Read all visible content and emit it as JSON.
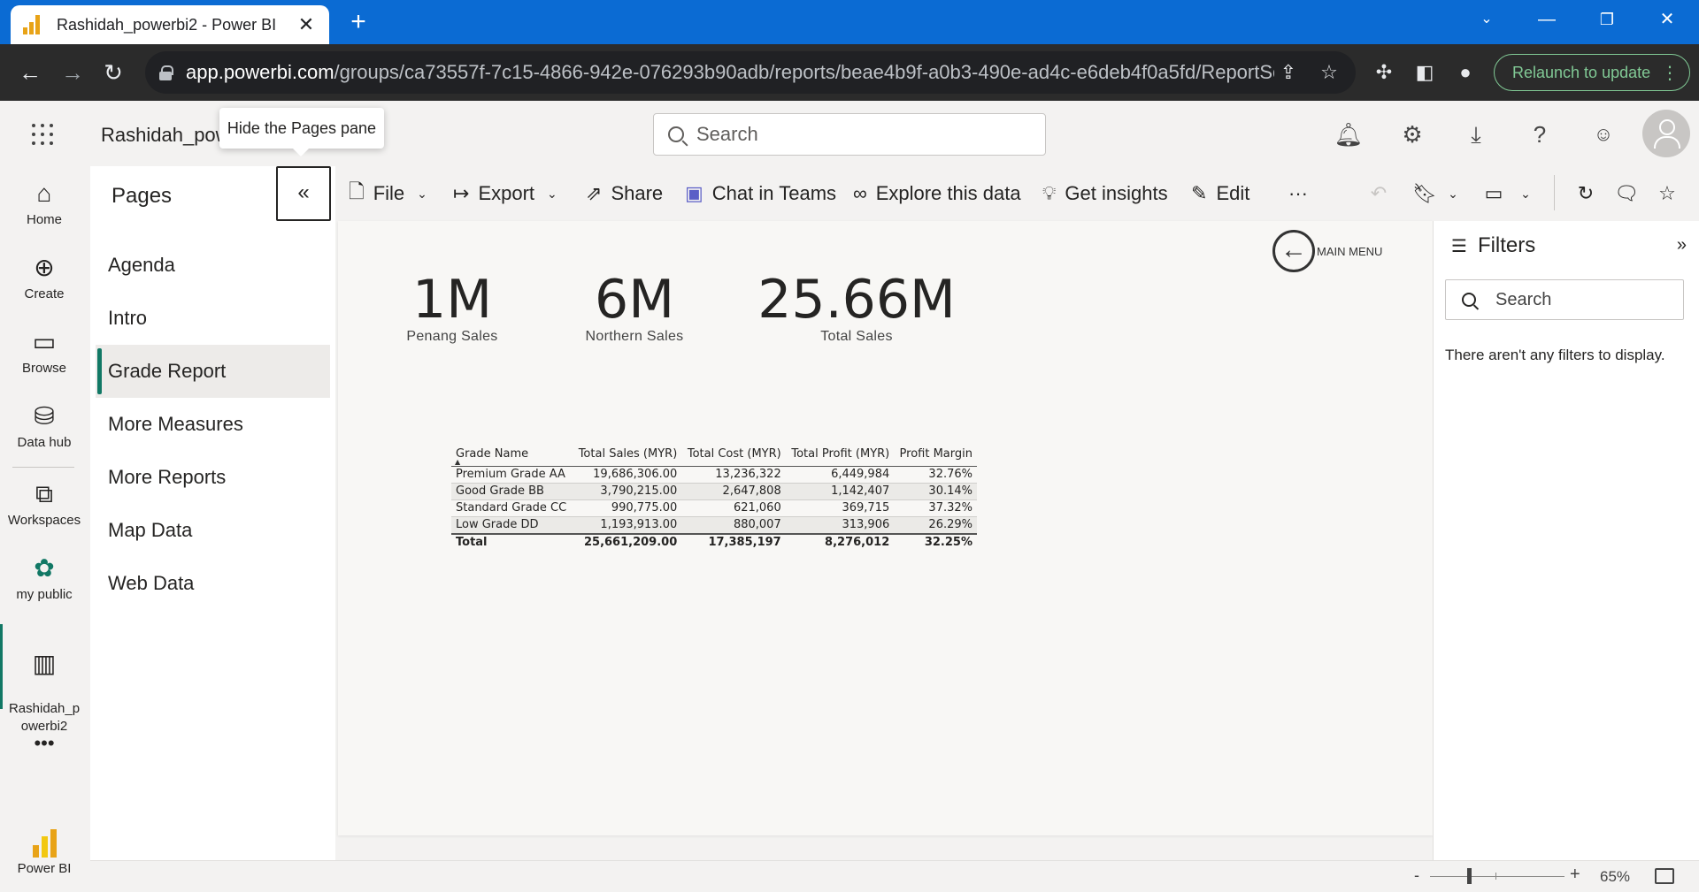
{
  "browser": {
    "tab_title": "Rashidah_powerbi2 - Power BI",
    "close_glyph": "✕",
    "newtab_glyph": "+",
    "url_host": "app.powerbi.com",
    "url_path": "/groups/ca73557f-7c15-4866-942e-076293b90adb/reports/beae4b9f-a0b3-490e-ad4c-e6deb4f0a5fd/ReportSec...",
    "relaunch_label": "Relaunch to update",
    "accent_color": "#0b6bd3"
  },
  "header": {
    "workspace_name": "Rashidah_powe",
    "tooltip": "Hide the Pages pane",
    "search_placeholder": "Search"
  },
  "leftnav": {
    "items": [
      {
        "label": "Home",
        "icon": "home-icon"
      },
      {
        "label": "Create",
        "icon": "plus-circle-icon"
      },
      {
        "label": "Browse",
        "icon": "folder-icon"
      },
      {
        "label": "Data hub",
        "icon": "database-icon"
      },
      {
        "label": "Workspaces",
        "icon": "workspaces-icon"
      },
      {
        "label": "my public",
        "icon": "people-icon"
      },
      {
        "label": "Rashidah_p\nowerbi2",
        "icon": "report-icon"
      }
    ],
    "more": "•••",
    "brand_label": "Power BI"
  },
  "pages": {
    "title": "Pages",
    "collapse_glyph": "«",
    "items": [
      {
        "label": "Agenda",
        "active": false
      },
      {
        "label": "Intro",
        "active": false
      },
      {
        "label": "Grade Report",
        "active": true
      },
      {
        "label": "More Measures",
        "active": false
      },
      {
        "label": "More Reports",
        "active": false
      },
      {
        "label": "Map Data",
        "active": false
      },
      {
        "label": "Web Data",
        "active": false
      }
    ]
  },
  "actions": {
    "file": "File",
    "export": "Export",
    "share": "Share",
    "chat": "Chat in Teams",
    "explore": "Explore this data",
    "insights": "Get insights",
    "edit": "Edit",
    "more": "···"
  },
  "report": {
    "main_menu": "MAIN MENU",
    "cards": [
      {
        "value": "1M",
        "label": "Penang Sales"
      },
      {
        "value": "6M",
        "label": "Northern Sales"
      },
      {
        "value": "25.66M",
        "label": "Total Sales"
      }
    ],
    "table": {
      "headers": [
        "Grade Name",
        "Total Sales (MYR)",
        "Total Cost (MYR)",
        "Total Profit (MYR)",
        "Profit Margin"
      ],
      "rows": [
        [
          "Premium Grade AA",
          "19,686,306.00",
          "13,236,322",
          "6,449,984",
          "32.76%"
        ],
        [
          "Good Grade BB",
          "3,790,215.00",
          "2,647,808",
          "1,142,407",
          "30.14%"
        ],
        [
          "Standard Grade CC",
          "990,775.00",
          "621,060",
          "369,715",
          "37.32%"
        ],
        [
          "Low Grade DD",
          "1,193,913.00",
          "880,007",
          "313,906",
          "26.29%"
        ]
      ],
      "total": [
        "Total",
        "25,661,209.00",
        "17,385,197",
        "8,276,012",
        "32.25%"
      ]
    }
  },
  "filters": {
    "title": "Filters",
    "collapse_glyph": "»",
    "search_placeholder": "Search",
    "empty_message": "There aren't any filters to display."
  },
  "status": {
    "zoom_minus": "-",
    "zoom_plus": "+",
    "zoom_level": "65%",
    "zoom_fraction": 0.29
  },
  "colors": {
    "active_accent": "#117865",
    "powerbi_yellow": "#e8a317"
  }
}
